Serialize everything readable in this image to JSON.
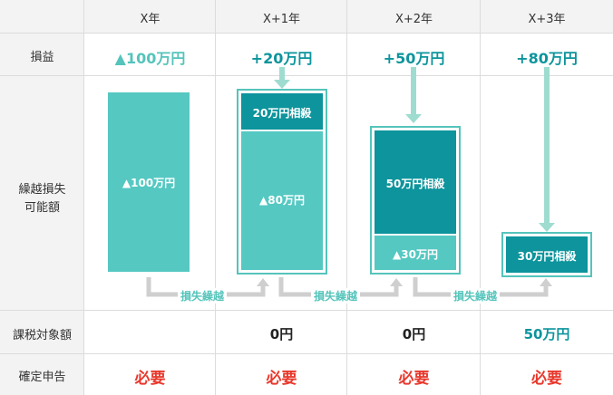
{
  "columns": [
    "X年",
    "X+1年",
    "X+2年",
    "X+3年"
  ],
  "rows": {
    "profit_loss": "損益",
    "carryforward": [
      "繰越損失",
      "可能額"
    ],
    "taxable_income": "課税対象額",
    "tax_return": "確定申告"
  },
  "profit_loss_values": [
    "▲100万円",
    "+20万円",
    "+50万円",
    "+80万円"
  ],
  "bars": {
    "x0": {
      "loss": "▲100万円"
    },
    "x1": {
      "offset": "20万円相殺",
      "remaining": "▲80万円"
    },
    "x2": {
      "offset": "50万円相殺",
      "remaining": "▲30万円"
    },
    "x3": {
      "offset": "30万円相殺"
    }
  },
  "carry_label": "損失繰越",
  "taxable_values": [
    "",
    "0円",
    "0円",
    "50万円"
  ],
  "tax_return_values": [
    "必要",
    "必要",
    "必要",
    "必要"
  ],
  "colors": {
    "light_teal": "#55c8c2",
    "dark_teal": "#0d949c",
    "arrow_teal": "#9fdcd0",
    "header_bg": "#f3f3f3",
    "required_red": "#e8382c"
  }
}
